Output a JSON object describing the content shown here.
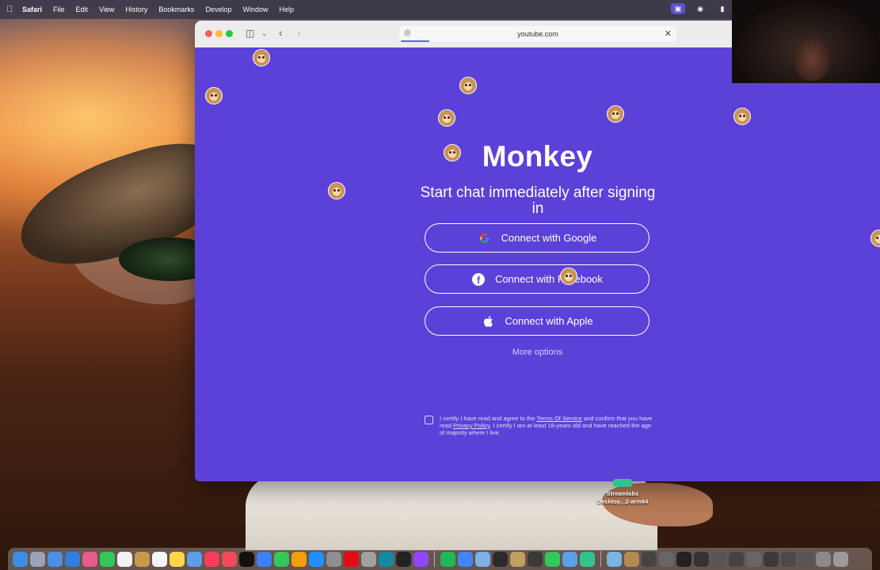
{
  "menubar": {
    "app_name": "Safari",
    "items": [
      "File",
      "Edit",
      "View",
      "History",
      "Bookmarks",
      "Develop",
      "Window",
      "Help"
    ]
  },
  "browser": {
    "url": "youtube.com"
  },
  "page": {
    "title": "Monkey",
    "subtitle": "Start chat immediately after signing in",
    "buttons": {
      "google": "Connect with Google",
      "facebook": "Connect with Facebook",
      "apple": "Connect with Apple"
    },
    "more_options": "More options",
    "terms": {
      "part1": "I certify I have read and agree to the ",
      "terms_link": "Terms Of Service",
      "part2": " and confirm that you have read ",
      "privacy_link": "Privacy Policy",
      "part3": ". I certify I am at least 18-years old and have reached the age of majority where I live.",
      "checked": false
    }
  },
  "desktop_icon": {
    "line1": "Streamlabs",
    "line2": "Desktop...2-arm64"
  },
  "colors": {
    "page_bg": "#5c41d8",
    "google_red": "#ea4335",
    "google_blue": "#4285f4",
    "google_yellow": "#fbbc05",
    "google_green": "#34a853"
  },
  "icons": {
    "google": "google-logo-icon",
    "facebook": "facebook-logo-icon",
    "apple": "apple-logo-icon"
  }
}
